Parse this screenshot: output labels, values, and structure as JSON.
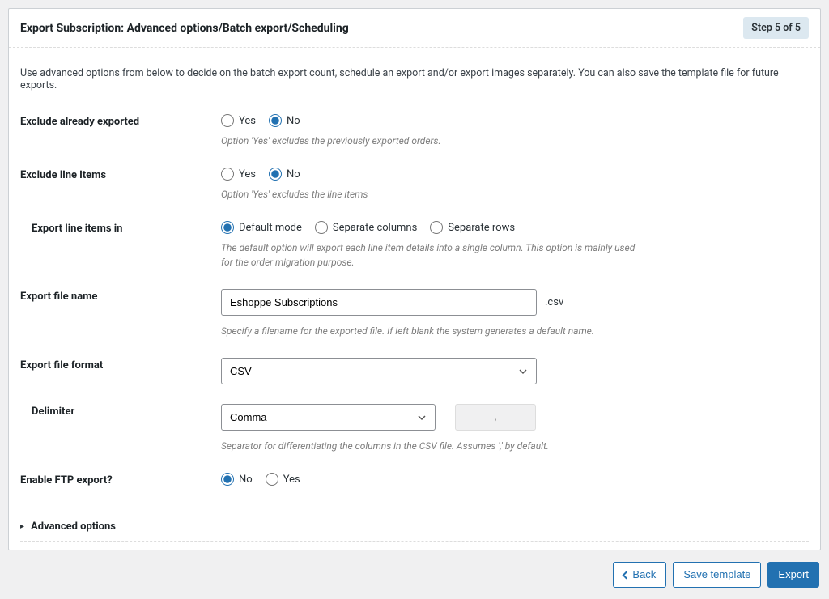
{
  "header": {
    "title": "Export Subscription: Advanced options/Batch export/Scheduling",
    "step_label": "Step 5 of 5"
  },
  "intro": "Use advanced options from below to decide on the batch export count, schedule an export and/or export images separately. You can also save the template file for future exports.",
  "fields": {
    "exclude_exported": {
      "label": "Exclude already exported",
      "yes": "Yes",
      "no": "No",
      "help": "Option 'Yes' excludes the previously exported orders."
    },
    "exclude_line_items": {
      "label": "Exclude line items",
      "yes": "Yes",
      "no": "No",
      "help": "Option 'Yes' excludes the line items"
    },
    "export_line_items_in": {
      "label": "Export line items in",
      "opt1": "Default mode",
      "opt2": "Separate columns",
      "opt3": "Separate rows",
      "help": "The default option will export each line item details into a single column. This option is mainly used for the order migration purpose."
    },
    "filename": {
      "label": "Export file name",
      "value": "Eshoppe Subscriptions",
      "ext": ".csv",
      "help": "Specify a filename for the exported file. If left blank the system generates a default name."
    },
    "fileformat": {
      "label": "Export file format",
      "value": "CSV"
    },
    "delimiter": {
      "label": "Delimiter",
      "value": "Comma",
      "symbol": ",",
      "help": "Separator for differentiating the columns in the CSV file. Assumes ',' by default."
    },
    "ftp": {
      "label": "Enable FTP export?",
      "no": "No",
      "yes": "Yes"
    },
    "advanced": {
      "label": "Advanced options"
    }
  },
  "footer": {
    "back": "Back",
    "save": "Save template",
    "export": "Export"
  }
}
